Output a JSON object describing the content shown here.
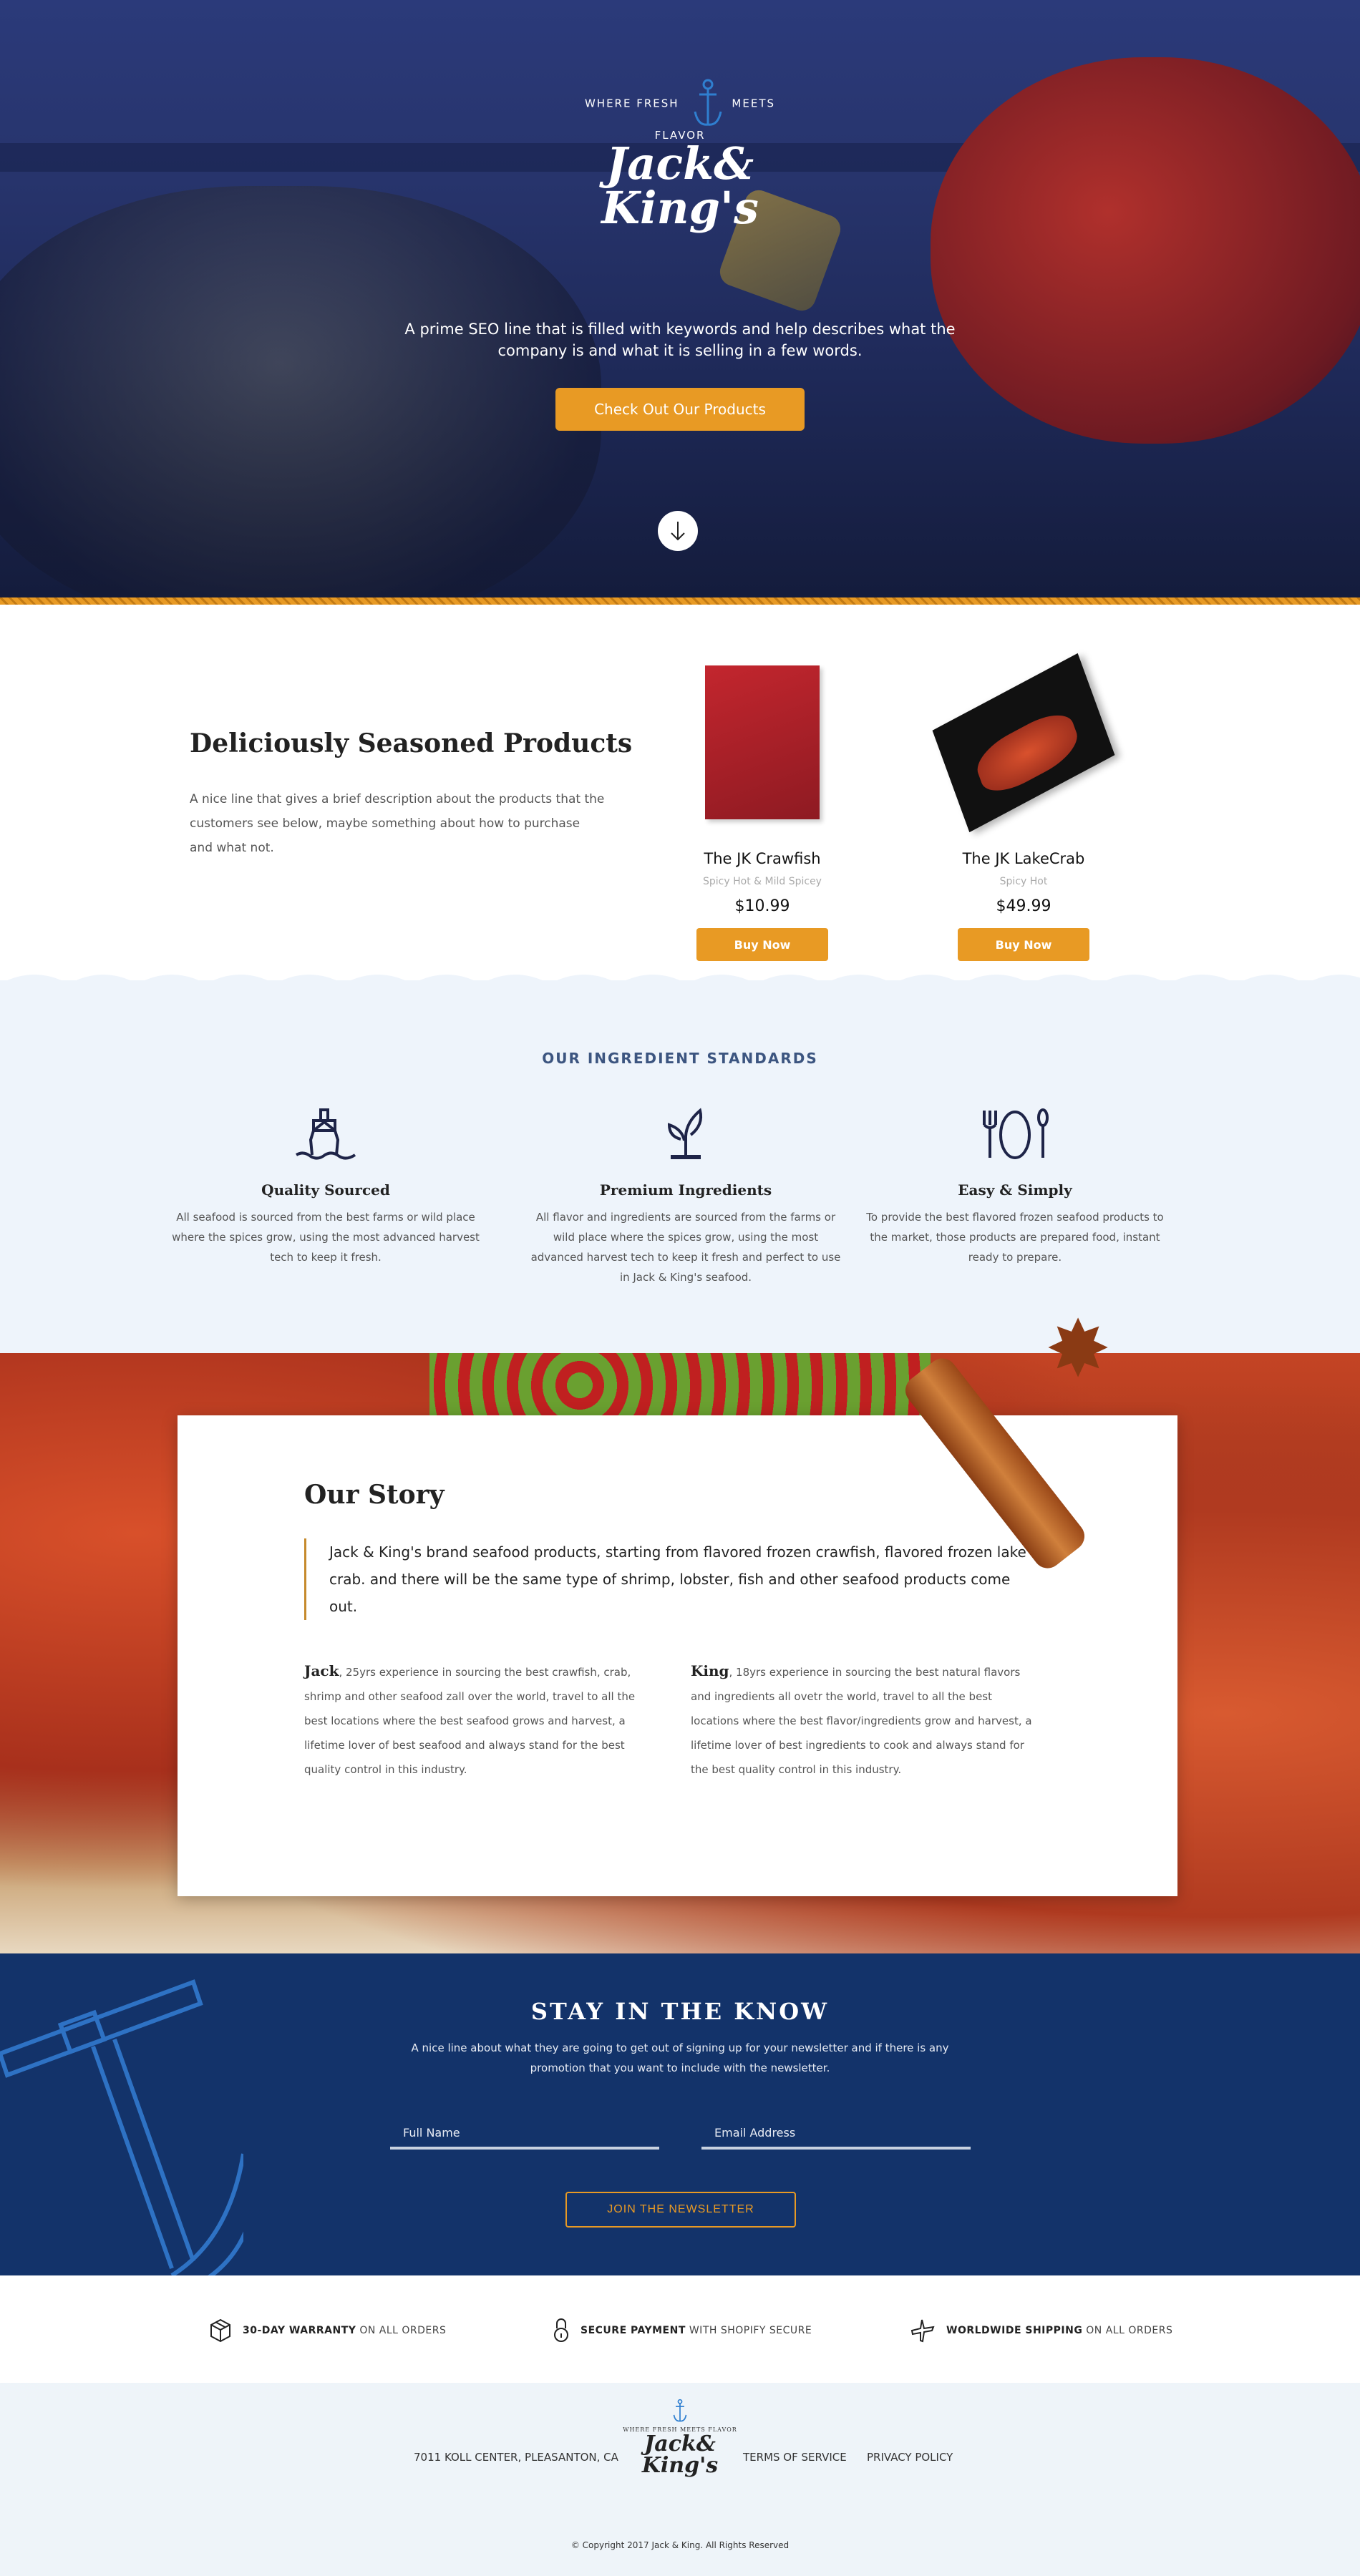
{
  "hero": {
    "logo": {
      "arc_left": "WHERE FRESH",
      "arc_right": "MEETS FLAVOR",
      "name_line1": "Jack&",
      "name_line2": "King's"
    },
    "tagline": "A prime SEO line that is filled with keywords and help describes what the company is and what it is selling in a few words.",
    "cta_label": "Check Out Our Products"
  },
  "products_section": {
    "title": "Deliciously Seasoned Products",
    "description": "A nice line that gives a brief description about the products that the customers see below, maybe something about how to purchase and what not.",
    "products": [
      {
        "name": "The JK Crawfish",
        "subtitle": "Spicy Hot & Mild Spicey",
        "price": "$10.99",
        "button": "Buy Now"
      },
      {
        "name": "The JK LakeCrab",
        "subtitle": "Spicy Hot",
        "price": "$49.99",
        "button": "Buy Now"
      }
    ]
  },
  "standards": {
    "title": "OUR INGREDIENT STANDARDS",
    "items": [
      {
        "icon": "ship-icon",
        "title": "Quality Sourced",
        "text": "All seafood is sourced from the best farms or wild place where the spices grow, using the most advanced harvest tech to keep it fresh."
      },
      {
        "icon": "sprout-icon",
        "title": "Premium Ingredients",
        "text": "All flavor and ingredients are sourced from the farms or wild place where the spices grow, using the most advanced harvest tech to keep it fresh and perfect to use in Jack & King's seafood."
      },
      {
        "icon": "dining-icon",
        "title": "Easy & Simply",
        "text": "To provide the best flavored frozen seafood products to the market, those products are prepared food, instant ready to prepare."
      }
    ]
  },
  "story": {
    "title": "Our Story",
    "quote": "Jack & King's brand seafood products, starting from flavored frozen crawfish, flavored frozen lake crab. and there will be the same type of shrimp, lobster, fish and other seafood products come out.",
    "bios": [
      {
        "name": "Jack",
        "text": ", 25yrs experience in sourcing the best crawfish, crab, shrimp and other seafood zall over the world, travel to all the best locations where the best seafood grows and harvest, a lifetime lover of best seafood and always stand for the best quality control in this industry."
      },
      {
        "name": "King",
        "text": ", 18yrs experience in sourcing the best natural flavors and ingredients all ovetr the world, travel to all the best locations where the best flavor/ingredients grow and harvest, a lifetime lover of best ingredients to cook and always stand for the best quality control in this industry."
      }
    ]
  },
  "newsletter": {
    "title": "STAY IN THE KNOW",
    "description": "A nice line about what they are going to get out of signing up for your newsletter and if there is any promotion that you want to include with the newsletter.",
    "name_placeholder": "Full Name",
    "email_placeholder": "Email Address",
    "button": "JOIN THE NEWSLETTER"
  },
  "features": [
    {
      "icon": "box-icon",
      "bold": "30-DAY WARRANTY",
      "rest": " ON ALL ORDERS"
    },
    {
      "icon": "lock-icon",
      "bold": "SECURE PAYMENT",
      "rest": " WITH SHOPIFY SECURE"
    },
    {
      "icon": "plane-icon",
      "bold": "WORLDWIDE SHIPPING",
      "rest": " ON ALL ORDERS"
    }
  ],
  "footer": {
    "address": "7011 KOLL CENTER, PLEASANTON, CA",
    "terms": "TERMS OF SERVICE",
    "privacy": "PRIVACY POLICY",
    "logo": {
      "arc": "WHERE FRESH MEETS FLAVOR",
      "name_line1": "Jack&",
      "name_line2": "King's"
    },
    "copyright": "© Copyright 2017 Jack & King. All Rights Reserved"
  },
  "colors": {
    "accent": "#e89a24",
    "navy": "#13336a",
    "light_bg": "#eef4fb",
    "icon_dark": "#1e2448"
  }
}
